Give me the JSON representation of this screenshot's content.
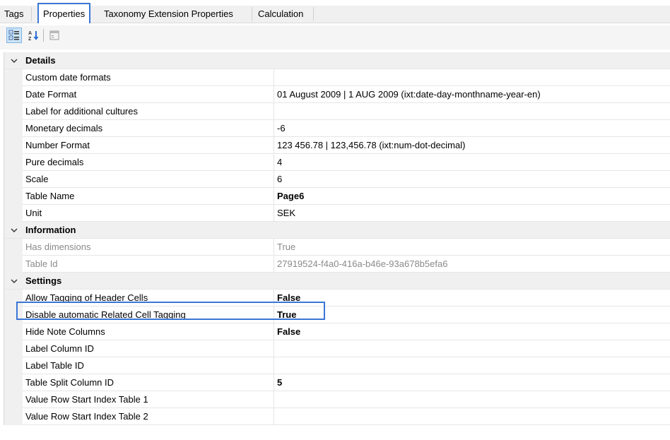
{
  "tabs": [
    "Tags",
    "Properties",
    "Taxonomy Extension Properties",
    "Calculation"
  ],
  "active_tab": "Properties",
  "toolbar": {
    "categorized_icon": "categorized-view-icon",
    "alphabetical_icon": "sort-alphabetical-icon",
    "property_pages_icon": "property-pages-icon"
  },
  "colors": {
    "highlight": "#3a76d6",
    "gutter": "#f0f0f0"
  },
  "categories": [
    {
      "title": "Details",
      "rows": [
        {
          "name": "Custom date formats",
          "value": ""
        },
        {
          "name": "Date Format",
          "value": "01 August 2009 | 1 AUG 2009 (ixt:date-day-monthname-year-en)"
        },
        {
          "name": "Label for additional cultures",
          "value": ""
        },
        {
          "name": "Monetary decimals",
          "value": "-6"
        },
        {
          "name": "Number Format",
          "value": "123 456.78 | 123,456.78 (ixt:num-dot-decimal)"
        },
        {
          "name": "Pure decimals",
          "value": "4"
        },
        {
          "name": "Scale",
          "value": "6"
        },
        {
          "name": "Table Name",
          "value": "Page6",
          "bold": true
        },
        {
          "name": "Unit",
          "value": "SEK"
        }
      ]
    },
    {
      "title": "Information",
      "rows": [
        {
          "name": "Has dimensions",
          "value": "True",
          "disabled": true
        },
        {
          "name": "Table Id",
          "value": "27919524-f4a0-416a-b46e-93a678b5efa6",
          "disabled": true
        }
      ]
    },
    {
      "title": "Settings",
      "rows": [
        {
          "name": "Allow Tagging of Header Cells",
          "value": "False",
          "bold": true
        },
        {
          "name": "Disable automatic Related Cell Tagging",
          "value": "True",
          "bold": true
        },
        {
          "name": "Hide Note Columns",
          "value": "False",
          "bold": true
        },
        {
          "name": "Label Column ID",
          "value": ""
        },
        {
          "name": "Label Table ID",
          "value": ""
        },
        {
          "name": "Table Split Column ID",
          "value": "5",
          "bold": true
        },
        {
          "name": "Value Row Start Index Table 1",
          "value": ""
        },
        {
          "name": "Value Row Start Index Table 2",
          "value": ""
        }
      ]
    }
  ]
}
